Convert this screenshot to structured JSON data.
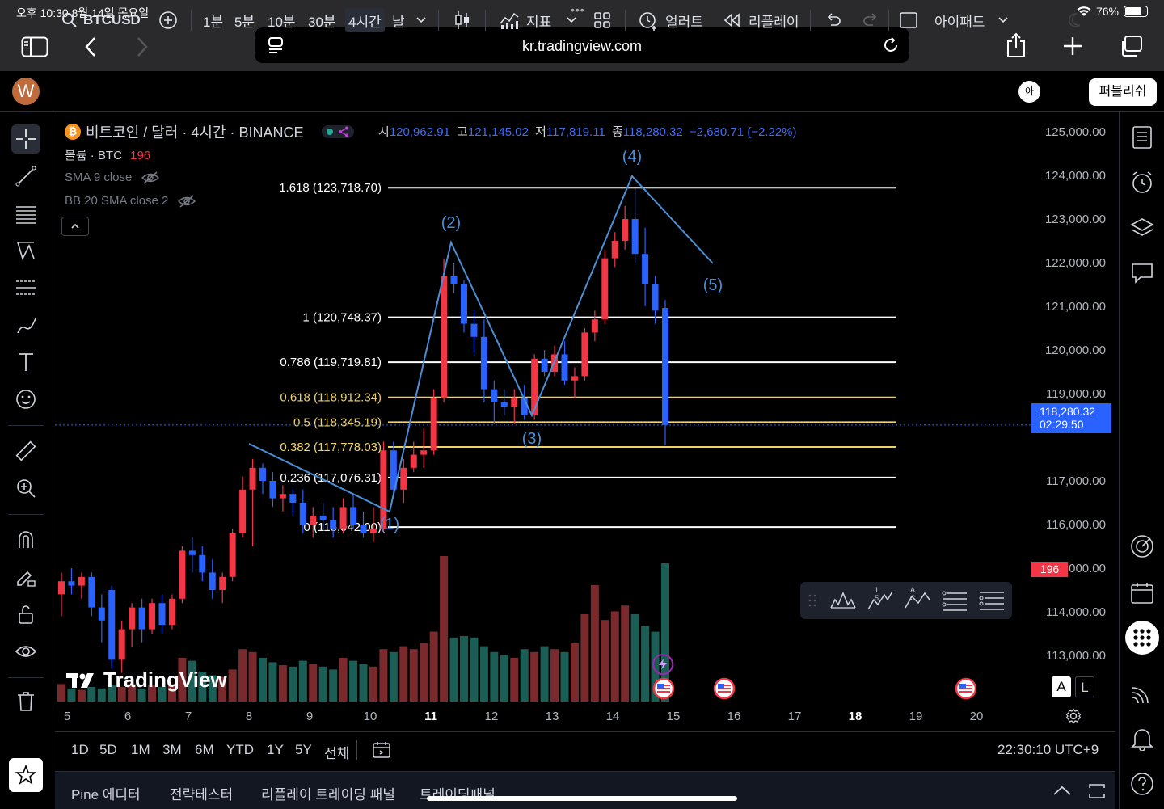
{
  "status_bar": {
    "time": "오후 10:30   8월 14일 목요일",
    "battery": "76%",
    "battery_level": 0.76
  },
  "browser": {
    "url": "kr.tradingview.com"
  },
  "toolbar": {
    "avatar_letter": "W",
    "symbol": "BTCUSD",
    "timeframes": [
      "1분",
      "5분",
      "10분",
      "30분",
      "4시간",
      "날"
    ],
    "active_timeframe": "4시간",
    "indicators_label": "지표",
    "alert_label": "얼러트",
    "replay_label": "리플레이",
    "layout_label": "아이패드",
    "mini_avatar": "아",
    "publish_label": "퍼블리쉬"
  },
  "legend": {
    "title": "비트코인 / 달러 · 4시간 · BINANCE",
    "coin_symbol": "₿",
    "ohlc": {
      "open_label": "시",
      "open": "120,962.91",
      "high_label": "고",
      "high": "121,145.02",
      "low_label": "저",
      "low": "117,819.11",
      "close_label": "종",
      "close": "118,280.32",
      "change": "−2,680.71 (−2.22%)"
    },
    "volume_label": "볼륨 · BTC",
    "volume_value": "196",
    "sma": "SMA 9 close",
    "bb": "BB 20 SMA close 2"
  },
  "price_axis": {
    "labels": [
      "125,000.00",
      "124,000.00",
      "123,000.00",
      "122,000.00",
      "121,000.00",
      "120,000.00",
      "119,000.00",
      "117,000.00",
      "116,000.00",
      "115,000.00",
      "114,000.00",
      "113,000.00"
    ],
    "current_price": "118,280.32",
    "countdown": "02:29:50",
    "volume_tag": "196"
  },
  "time_axis": {
    "labels": [
      "5",
      "6",
      "7",
      "8",
      "9",
      "10",
      "11",
      "12",
      "13",
      "14",
      "15",
      "16",
      "17",
      "18",
      "19",
      "20"
    ]
  },
  "fib_levels": [
    {
      "label": "1.618 (123,718.70)",
      "price": 123718.7,
      "color": "#ffffff"
    },
    {
      "label": "1 (120,748.37)",
      "price": 120748.37,
      "color": "#ffffff"
    },
    {
      "label": "0.786 (119,719.81)",
      "price": 119719.81,
      "color": "#ffffff"
    },
    {
      "label": "0.618 (118,912.34)",
      "price": 118912.34,
      "color": "#f0d264"
    },
    {
      "label": "0.5 (118,345.19)",
      "price": 118345.19,
      "color": "#f0d264"
    },
    {
      "label": "0.382 (117,778.03)",
      "price": 117778.03,
      "color": "#f0d264"
    },
    {
      "label": "0.236 (117,076.31)",
      "price": 117076.31,
      "color": "#ffffff"
    },
    {
      "label": "0 (115,942.00)",
      "price": 115942.0,
      "color": "#ffffff"
    }
  ],
  "wave_labels": [
    "(1)",
    "(2)",
    "(3)",
    "(4)",
    "(5)"
  ],
  "watermark": "TradingView",
  "drawing_panel_labels": {
    "elliott_num": "1 5",
    "elliott_abc": "A C"
  },
  "scale_buttons": [
    "A",
    "L"
  ],
  "range_bar": {
    "ranges": [
      "1D",
      "5D",
      "1M",
      "3M",
      "6M",
      "YTD",
      "1Y",
      "5Y",
      "전체"
    ],
    "clock": "22:30:10 UTC+9"
  },
  "bottom_panel": {
    "tabs": [
      "Pine 에디터",
      "전략테스터",
      "리플레이 트레이딩 패널",
      "트레이딩패널"
    ]
  },
  "colors": {
    "up": "#f23645",
    "down": "#2962ff",
    "vol_up": "#7a2a2c",
    "vol_down": "#1b5e55",
    "fib_gold": "#f0d264",
    "wave": "#4a8fd6",
    "accent": "#2962ff"
  },
  "chart_data": {
    "type": "candlestick",
    "y_range": [
      112500,
      125000
    ],
    "candles": [
      {
        "o": 114400,
        "h": 114900,
        "l": 113900,
        "c": 114700
      },
      {
        "o": 114700,
        "h": 115000,
        "l": 114400,
        "c": 114600
      },
      {
        "o": 114600,
        "h": 114900,
        "l": 114300,
        "c": 114800
      },
      {
        "o": 114800,
        "h": 114900,
        "l": 113900,
        "c": 114100
      },
      {
        "o": 114100,
        "h": 114400,
        "l": 113300,
        "c": 113800
      },
      {
        "o": 114500,
        "h": 114600,
        "l": 112700,
        "c": 112900
      },
      {
        "o": 112900,
        "h": 113800,
        "l": 112600,
        "c": 113600
      },
      {
        "o": 113600,
        "h": 114200,
        "l": 113200,
        "c": 114100
      },
      {
        "o": 114100,
        "h": 114300,
        "l": 113300,
        "c": 113600
      },
      {
        "o": 113600,
        "h": 114300,
        "l": 113500,
        "c": 114200
      },
      {
        "o": 114200,
        "h": 114400,
        "l": 113500,
        "c": 113700
      },
      {
        "o": 113700,
        "h": 114400,
        "l": 113600,
        "c": 114300
      },
      {
        "o": 114300,
        "h": 115500,
        "l": 114200,
        "c": 115400
      },
      {
        "o": 115400,
        "h": 115700,
        "l": 114900,
        "c": 115300
      },
      {
        "o": 115300,
        "h": 115500,
        "l": 114700,
        "c": 114900
      },
      {
        "o": 114900,
        "h": 115200,
        "l": 114300,
        "c": 114500
      },
      {
        "o": 114500,
        "h": 114900,
        "l": 114200,
        "c": 114800
      },
      {
        "o": 114800,
        "h": 115900,
        "l": 114700,
        "c": 115800
      },
      {
        "o": 115800,
        "h": 117100,
        "l": 115700,
        "c": 116800
      },
      {
        "o": 116800,
        "h": 117500,
        "l": 115500,
        "c": 117300
      },
      {
        "o": 117300,
        "h": 117400,
        "l": 116700,
        "c": 117000
      },
      {
        "o": 117000,
        "h": 117200,
        "l": 116400,
        "c": 116600
      },
      {
        "o": 116600,
        "h": 116900,
        "l": 116300,
        "c": 116700
      },
      {
        "o": 116700,
        "h": 116800,
        "l": 116200,
        "c": 116500
      },
      {
        "o": 116500,
        "h": 116800,
        "l": 115800,
        "c": 116000
      },
      {
        "o": 116000,
        "h": 116400,
        "l": 115700,
        "c": 116200
      },
      {
        "o": 116200,
        "h": 116500,
        "l": 115900,
        "c": 116100
      },
      {
        "o": 116100,
        "h": 116400,
        "l": 115700,
        "c": 115900
      },
      {
        "o": 115900,
        "h": 116600,
        "l": 115800,
        "c": 116400
      },
      {
        "o": 116400,
        "h": 116700,
        "l": 115900,
        "c": 116000
      },
      {
        "o": 116000,
        "h": 116300,
        "l": 115700,
        "c": 115800
      },
      {
        "o": 115800,
        "h": 116400,
        "l": 115600,
        "c": 115900
      },
      {
        "o": 115900,
        "h": 117900,
        "l": 115800,
        "c": 117700
      },
      {
        "o": 117700,
        "h": 117900,
        "l": 116600,
        "c": 116800
      },
      {
        "o": 116800,
        "h": 117500,
        "l": 116500,
        "c": 117300
      },
      {
        "o": 117300,
        "h": 117900,
        "l": 117200,
        "c": 117600
      },
      {
        "o": 117600,
        "h": 118200,
        "l": 117300,
        "c": 117700
      },
      {
        "o": 117700,
        "h": 119100,
        "l": 117600,
        "c": 118900
      },
      {
        "o": 118900,
        "h": 122100,
        "l": 118800,
        "c": 121700
      },
      {
        "o": 121700,
        "h": 122000,
        "l": 121300,
        "c": 121500
      },
      {
        "o": 121500,
        "h": 121600,
        "l": 120400,
        "c": 120600
      },
      {
        "o": 120600,
        "h": 120900,
        "l": 119900,
        "c": 120300
      },
      {
        "o": 120300,
        "h": 120700,
        "l": 118800,
        "c": 119100
      },
      {
        "o": 119100,
        "h": 119300,
        "l": 118300,
        "c": 118800
      },
      {
        "o": 118800,
        "h": 119100,
        "l": 118500,
        "c": 118700
      },
      {
        "o": 118700,
        "h": 119100,
        "l": 118300,
        "c": 118900
      },
      {
        "o": 118900,
        "h": 119200,
        "l": 118400,
        "c": 118500
      },
      {
        "o": 118500,
        "h": 119900,
        "l": 118400,
        "c": 119800
      },
      {
        "o": 119800,
        "h": 120000,
        "l": 119400,
        "c": 119500
      },
      {
        "o": 119500,
        "h": 120100,
        "l": 119400,
        "c": 119900
      },
      {
        "o": 119900,
        "h": 120200,
        "l": 119200,
        "c": 119300
      },
      {
        "o": 119300,
        "h": 119600,
        "l": 118900,
        "c": 119400
      },
      {
        "o": 119400,
        "h": 120500,
        "l": 119300,
        "c": 120400
      },
      {
        "o": 120400,
        "h": 120900,
        "l": 120200,
        "c": 120700
      },
      {
        "o": 120700,
        "h": 122300,
        "l": 120600,
        "c": 122100
      },
      {
        "o": 122100,
        "h": 122700,
        "l": 121900,
        "c": 122500
      },
      {
        "o": 122500,
        "h": 123300,
        "l": 122300,
        "c": 123000
      },
      {
        "o": 123000,
        "h": 123700,
        "l": 122000,
        "c": 122200
      },
      {
        "o": 122200,
        "h": 122800,
        "l": 121000,
        "c": 121500
      },
      {
        "o": 121500,
        "h": 121700,
        "l": 120600,
        "c": 120900
      },
      {
        "o": 120963,
        "h": 121145,
        "l": 117819,
        "c": 118280
      }
    ],
    "volumes": [
      12,
      9,
      8,
      10,
      9,
      11,
      10,
      12,
      9,
      11,
      10,
      12,
      30,
      28,
      20,
      18,
      17,
      22,
      36,
      34,
      30,
      27,
      25,
      24,
      28,
      26,
      24,
      22,
      30,
      28,
      26,
      24,
      36,
      34,
      38,
      36,
      40,
      48,
      100,
      44,
      45,
      44,
      38,
      34,
      32,
      30,
      36,
      34,
      38,
      36,
      34,
      40,
      60,
      80,
      56,
      62,
      66,
      60,
      52,
      48,
      95
    ]
  }
}
